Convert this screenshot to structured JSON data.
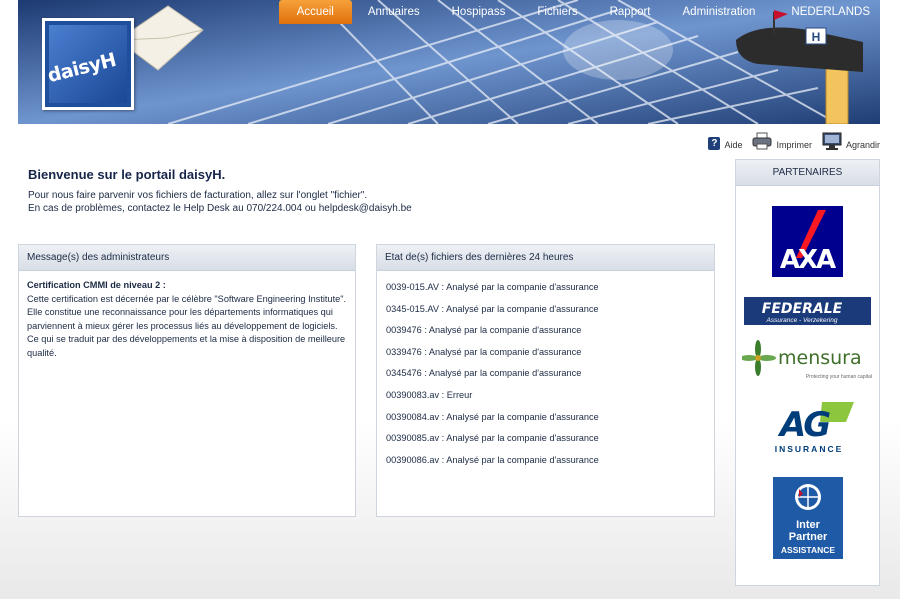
{
  "nav": {
    "items": [
      "Accueil",
      "Annuaires",
      "Hospipass",
      "Fichiers",
      "Rapport",
      "Administration"
    ],
    "active": "Accueil",
    "language": "NEDERLANDS"
  },
  "logo": {
    "text": "daisyH"
  },
  "tools": {
    "help": "Aide",
    "print": "Imprimer",
    "zoom": "Agrandir"
  },
  "welcome": {
    "title": "Bienvenue sur le portail daisyH.",
    "line1": "Pour nous faire parvenir vos fichiers de facturation, allez sur l'onglet \"fichier\".",
    "line2": "En cas de problèmes, contactez le Help Desk au 070/224.004 ou helpdesk@daisyh.be"
  },
  "admin_panel": {
    "title": "Message(s) des administrateurs",
    "heading": "Certification CMMI de niveau 2 :",
    "body": "Cette certification est décernée par le célèbre \"Software Engineering Institute\". Elle constitue une reconnaissance pour les départements informatiques qui parviennent à mieux gérer les processus liés au développement de logiciels. Ce qui se traduit par des développements et la mise à disposition de meilleure qualité."
  },
  "status_panel": {
    "title": "Etat de(s) fichiers des dernières 24 heures",
    "items": [
      "0039-015.AV : Analysé par la companie d'assurance",
      "0345-015.AV : Analysé par la companie d'assurance",
      "0039476 : Analysé par la companie d'assurance",
      "0339476 : Analysé par la companie d'assurance",
      "0345476 : Analysé par la companie d'assurance",
      "00390083.av : Erreur",
      "00390084.av : Analysé par la companie d'assurance",
      "00390085.av : Analysé par la companie d'assurance",
      "00390086.av : Analysé par la companie d'assurance"
    ]
  },
  "partners": {
    "title": "PARTENAIRES",
    "axa": "AXA",
    "federale": "FEDERALE",
    "federale_sub": "Assurance - Verzekering",
    "mensura": "mensura",
    "mensura_sub": "Protecting your human capital",
    "ag": "AG",
    "ag_sub": "INSURANCE",
    "ip_line1": "Inter",
    "ip_line2": "Partner",
    "ip_line3": "ASSISTANCE"
  },
  "colors": {
    "nav_active": "#e8800f",
    "brand_blue": "#1f4e9c",
    "panel_head": "#d8dee7"
  }
}
